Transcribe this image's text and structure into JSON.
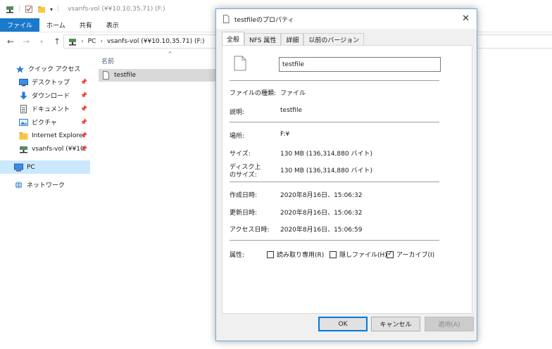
{
  "explorer": {
    "title": "vsanfs-vol (¥¥10.10.35.71) (F:)",
    "ribbon_tabs": [
      "ファイル",
      "ホーム",
      "共有",
      "表示"
    ],
    "address": {
      "root": "PC",
      "location": "vsanfs-vol (¥¥10.10.35.71) (F:)"
    },
    "sidebar": [
      {
        "label": "クイック アクセス",
        "icon": "star-icon"
      },
      {
        "label": "デスクトップ",
        "icon": "desktop-icon",
        "pinned": true
      },
      {
        "label": "ダウンロード",
        "icon": "download-icon",
        "pinned": true
      },
      {
        "label": "ドキュメント",
        "icon": "documents-icon",
        "pinned": true
      },
      {
        "label": "ピクチャ",
        "icon": "pictures-icon",
        "pinned": true
      },
      {
        "label": "Internet Explorer",
        "icon": "folder-icon",
        "pinned": true
      },
      {
        "label": "vsanfs-vol (¥¥10.",
        "icon": "network-drive-icon",
        "pinned": true
      },
      {
        "label": "PC",
        "icon": "pc-icon"
      },
      {
        "label": "ネットワーク",
        "icon": "network-icon"
      }
    ],
    "column_name": "名前",
    "files": [
      {
        "name": "testfile"
      }
    ]
  },
  "dialog": {
    "title": "testfileのプロパティ",
    "tabs": [
      "全般",
      "NFS 属性",
      "詳細",
      "以前のバージョン"
    ],
    "file_name": "testfile",
    "fields": {
      "type_label": "ファイルの種類:",
      "type_value": "ファイル",
      "desc_label": "説明:",
      "desc_value": "testfile",
      "location_label": "場所:",
      "location_value": "F:¥",
      "size_label": "サイズ:",
      "size_value": "130 MB (136,314,880 バイト)",
      "disk_size_label_1": "ディスク上",
      "disk_size_label_2": "のサイズ:",
      "disk_size_value": "130 MB (136,314,880 バイト)",
      "created_label": "作成日時:",
      "created_value": "2020年8月16日、15:06:32",
      "modified_label": "更新日時:",
      "modified_value": "2020年8月16日、15:06:32",
      "accessed_label": "アクセス日時:",
      "accessed_value": "2020年8月16日、15:06:59"
    },
    "attributes": {
      "label": "属性:",
      "readonly": {
        "label": "読み取り専用(R)",
        "checked": false
      },
      "hidden": {
        "label": "隠しファイル(H)",
        "checked": false
      },
      "archive": {
        "label": "アーカイブ(I)",
        "checked": true
      }
    },
    "buttons": {
      "ok": "OK",
      "cancel": "キャンセル",
      "apply": "適用(A)"
    }
  }
}
